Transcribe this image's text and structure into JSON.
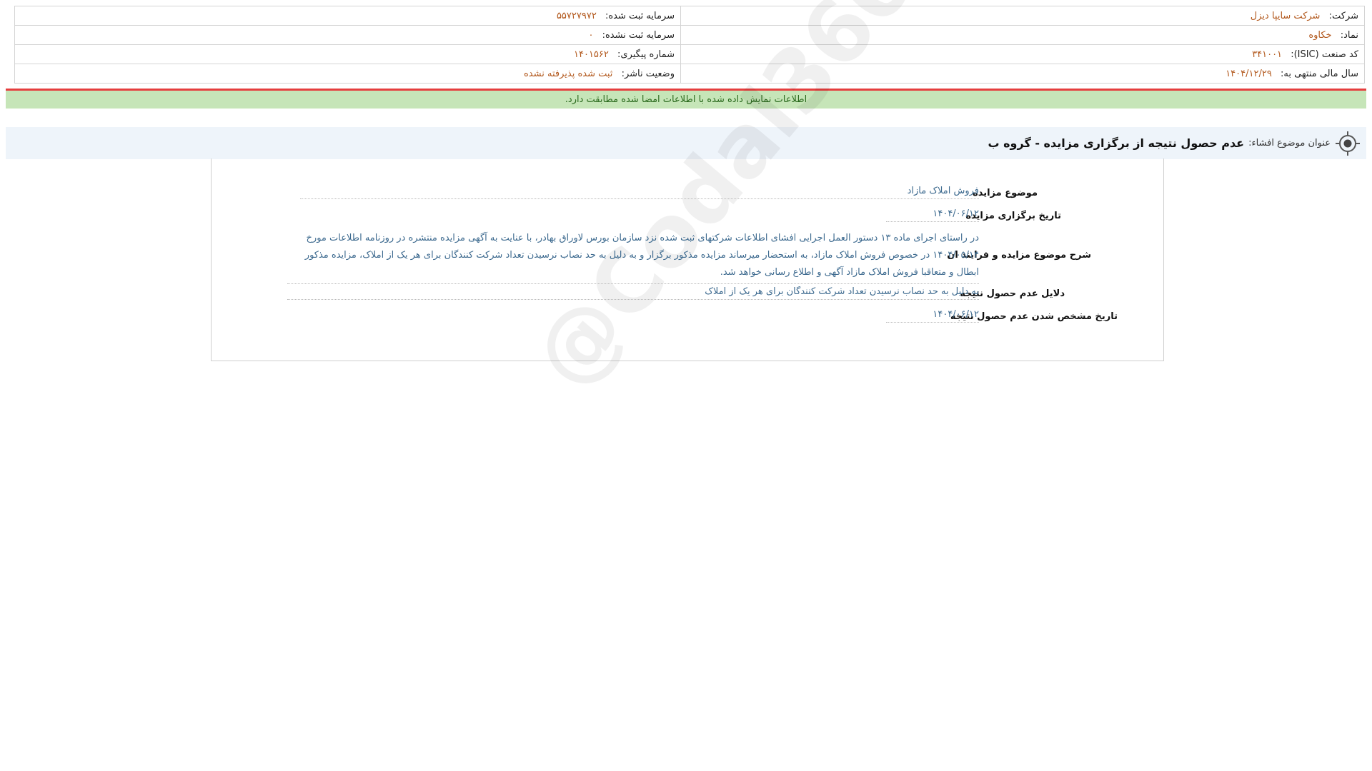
{
  "company_info": {
    "company_label": "شرکت:",
    "company_value": "شرکت سایپا دیزل",
    "symbol_label": "نماد:",
    "symbol_value": "خکاوه",
    "isic_label": "کد صنعت (ISIC):",
    "isic_value": "۳۴۱۰۰۱",
    "fiscal_label": "سال مالی منتهی به:",
    "fiscal_value": "۱۴۰۴/۱۲/۲۹",
    "reg_capital_label": "سرمایه ثبت شده:",
    "reg_capital_value": "۵۵۷۲۷۹۷۲",
    "unreg_capital_label": "سرمایه ثبت نشده:",
    "unreg_capital_value": "۰",
    "tracking_label": "شماره پیگیری:",
    "tracking_value": "۱۴۰۱۵۶۲",
    "status_label": "وضعیت ناشر:",
    "status_value": "ثبت شده پذیرفته نشده"
  },
  "banner": {
    "text": "اطلاعات نمایش داده شده با اطلاعات امضا شده مطابقت دارد."
  },
  "title": {
    "label": "عنوان موضوع افشاء:",
    "value": "عدم حصول نتیجه از برگزاری مزایده - گروه ب"
  },
  "fields": {
    "subject_label": "موضوع مزایده",
    "subject_value": "فروش املاک مازاد",
    "date_label": "تاریخ برگزاری مزایده",
    "date_value": "۱۴۰۴/۰۶/۱۲",
    "desc_label": "شرح موضوع مزایده و فرایند ان",
    "desc_value": "در راستای اجرای ماده ۱۳ دستور العمل اجرایی افشای اطلاعات شرکتهای ثبت شده نزد سازمان بورس لاوراق بهادر، با عنایت به آگهی مزایده منتشره در روزنامه اطلاعات مورخ ۱۴۰۴/۰۵/۱۴ در خصوص فروش املاک مازاد، به استحضار میرساند مزایده مذکور برگزار و به دلیل به حد نصاب نرسیدن تعداد شرکت کنندگان برای هر یک از املاک، مزایده مذکور ابطال و متعاقبا فروش املاک مازاد آگهی و اطلاع رسانی خواهد شد.",
    "reasons_label": "دلایل عدم حصول نتیجه",
    "reasons_value": "به دلیل به حد نصاب نرسیدن تعداد شرکت کنندگان برای هر یک از املاک",
    "result_date_label": "تاریخ مشخص شدن عدم حصول نتیجه",
    "result_date_value": "۱۴۰۴/۰۶/۱۲"
  },
  "watermark": "@Codal360"
}
